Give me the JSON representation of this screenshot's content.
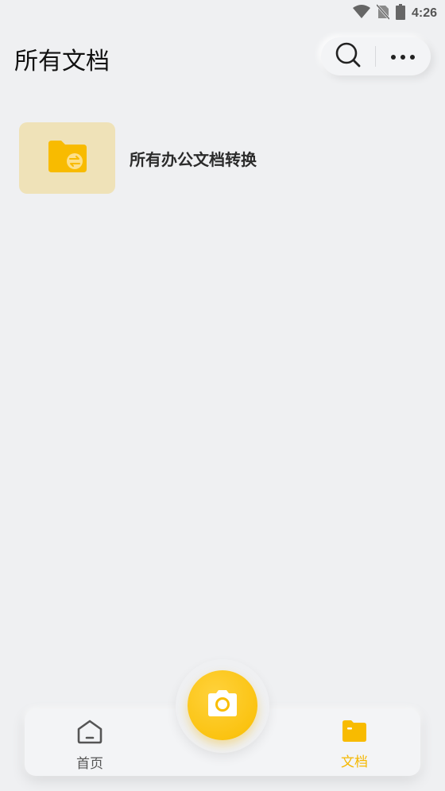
{
  "status_bar": {
    "time": "4:26",
    "icons": [
      "wifi-icon",
      "no-sim-icon",
      "battery-icon"
    ]
  },
  "header": {
    "title": "所有文档",
    "actions": [
      "search-icon",
      "more-options-icon"
    ]
  },
  "files": [
    {
      "name": "所有办公文档转换",
      "icon": "folder-convert-icon"
    }
  ],
  "bottom_nav": {
    "items": [
      {
        "label": "首页",
        "icon": "home-icon",
        "active": false
      },
      {
        "label": "文档",
        "icon": "folder-icon",
        "active": true
      }
    ],
    "camera_icon": "camera-icon"
  },
  "colors": {
    "accent": "#f9bd00",
    "folder_bg": "#efe2b8",
    "page_bg": "#eff0f2"
  }
}
